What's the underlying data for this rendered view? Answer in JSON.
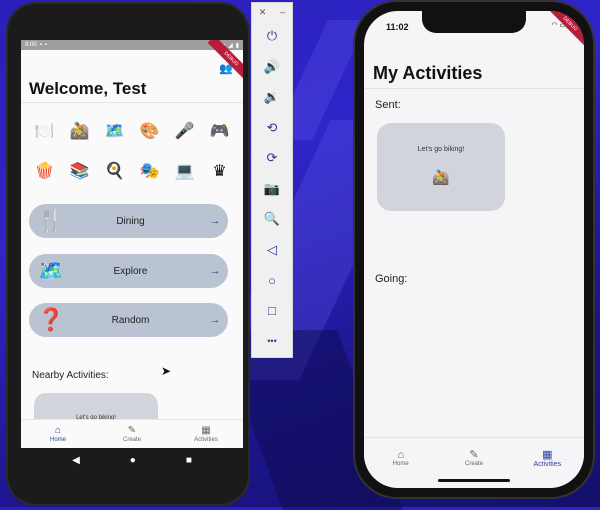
{
  "colors": {
    "accent": "#2a3f9e",
    "button_bg": "#b9c3d1",
    "card_bg": "#d1d5db"
  },
  "android": {
    "status": {
      "time": "9:00"
    },
    "debug_banner": "DEBUG",
    "title": "Welcome, Test",
    "emoji_row1": [
      "🍽️",
      "🚵",
      "🗺️",
      "🎨",
      "🎤",
      "🎮"
    ],
    "emoji_row2": [
      "🍿",
      "📚",
      "🍳",
      "🎭",
      "💻",
      "♛"
    ],
    "categories": [
      {
        "emoji": "🍴",
        "label": "Dining"
      },
      {
        "emoji": "🗺️",
        "label": "Explore"
      },
      {
        "emoji": "❓",
        "label": "Random"
      }
    ],
    "nearby_heading": "Nearby Activities:",
    "nearby_card_text": "Let's go biking!",
    "nav": [
      {
        "icon": "home-icon",
        "glyph": "⌂",
        "label": "Home"
      },
      {
        "icon": "edit-icon",
        "glyph": "✎",
        "label": "Create"
      },
      {
        "icon": "calendar-icon",
        "glyph": "▦",
        "label": "Activities"
      }
    ]
  },
  "toolbar": {
    "close": "✕",
    "minimize": "–",
    "items": [
      {
        "icon": "power-icon",
        "glyph": "⏻"
      },
      {
        "icon": "volume-up-icon",
        "glyph": "🔊"
      },
      {
        "icon": "volume-down-icon",
        "glyph": "🔉"
      },
      {
        "icon": "rotate-left-icon",
        "glyph": "⟲"
      },
      {
        "icon": "rotate-right-icon",
        "glyph": "⟳"
      },
      {
        "icon": "camera-icon",
        "glyph": "📷"
      },
      {
        "icon": "zoom-icon",
        "glyph": "🔍"
      },
      {
        "icon": "back-icon",
        "glyph": "◁"
      },
      {
        "icon": "home-circle-icon",
        "glyph": "○"
      },
      {
        "icon": "overview-icon",
        "glyph": "□"
      },
      {
        "icon": "more-icon",
        "glyph": "•••"
      }
    ]
  },
  "iphone": {
    "time": "11:02",
    "debug_banner": "DEBUG",
    "title": "My Activities",
    "sent_label": "Sent:",
    "card_text": "Let's go biking!",
    "card_emoji": "🚵",
    "going_label": "Going:",
    "nav": [
      {
        "icon": "home-icon",
        "glyph": "⌂",
        "label": "Home"
      },
      {
        "icon": "edit-icon",
        "glyph": "✎",
        "label": "Create"
      },
      {
        "icon": "calendar-icon",
        "glyph": "▦",
        "label": "Activities"
      }
    ]
  }
}
